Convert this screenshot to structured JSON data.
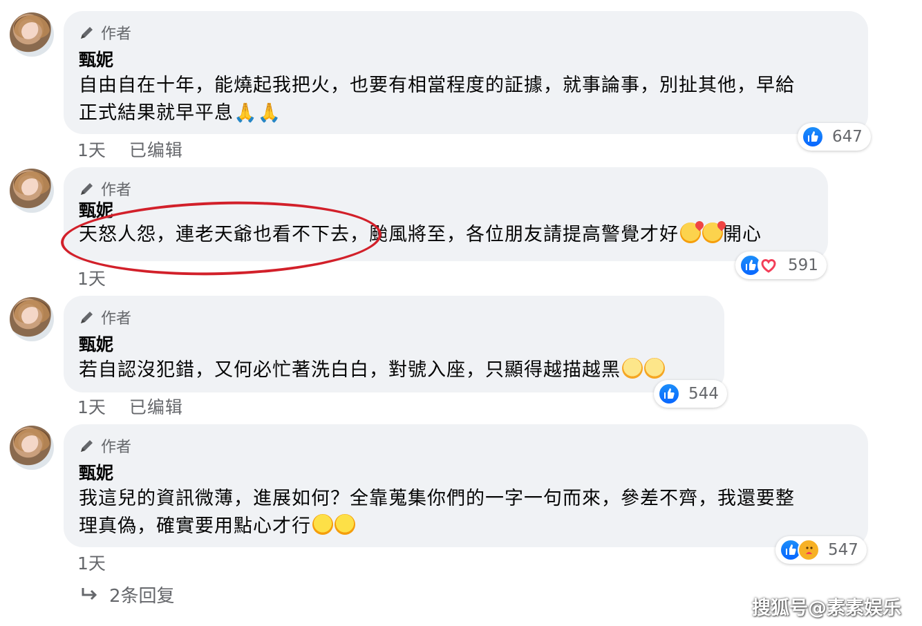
{
  "comments": [
    {
      "author_tag": "作者",
      "name": "甄妮",
      "text": "自由自在十年，能燒起我把火，也要有相當程度的証據，就事論事，別扯其他，早給\n正式結果就早平息",
      "time": "1天",
      "edited": "已编辑",
      "reaction_count": "647"
    },
    {
      "author_tag": "作者",
      "name": "甄妮",
      "text": "天怒人怨，連老天爺也看不下去，颱風將至，各位朋友請提高警覺才好",
      "text_suffix": "開心",
      "time": "1天",
      "reaction_count": "591"
    },
    {
      "author_tag": "作者",
      "name": "甄妮",
      "text": "若自認沒犯錯，又何必忙著洗白白，對號入座，只顯得越描越黑",
      "time": "1天",
      "edited": "已编辑",
      "reaction_count": "544"
    },
    {
      "author_tag": "作者",
      "name": "甄妮",
      "text": "我這兒的資訊微薄，進展如何？全靠蒐集你們的一字一句而來，參差不齊，我還要整\n理真偽，確實要用點心才行",
      "time": "1天",
      "reaction_count": "547"
    }
  ],
  "reply_link": "2条回复",
  "watermark": "搜狐号@素素娱乐",
  "colors": {
    "bubble_bg": "#f0f2f5",
    "meta_text": "#65676b",
    "like_blue": "#0866ff",
    "annotation_red": "#d2202a"
  },
  "icons": [
    "pencil-icon",
    "like-icon",
    "love-icon",
    "care-icon",
    "reply-arrow-icon"
  ]
}
